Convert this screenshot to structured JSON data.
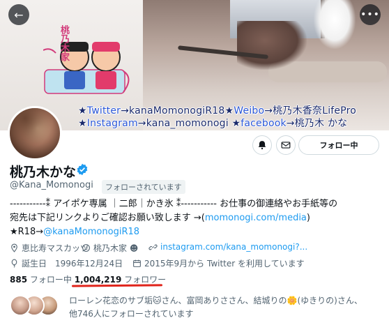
{
  "banner": {
    "kanji": "桃乃木家",
    "line1_parts": [
      "★",
      "Twitter",
      "→kanaMomonogiR18",
      "★",
      "Weibo",
      "→桃乃木香奈LifePro"
    ],
    "line2_parts": [
      "★",
      "Instagram",
      "→kana_momonogi",
      " ★",
      "facebook",
      "→桃乃木 かな"
    ]
  },
  "header": {
    "back_icon": "←",
    "more_icon": "•••"
  },
  "actions": {
    "follow_label": "フォロー中"
  },
  "profile": {
    "name": "桃乃木かな",
    "handle": "@Kana_Momonogi",
    "follows_you": "フォローされています"
  },
  "bio": {
    "line1": "-----------⁑ アイポケ専属 ｜二郎｜かき氷 ⁑----------- お仕事の御連絡やお手紙等の",
    "line2_prefix": "宛先は下記リンクよりご確認お願い致します →(",
    "line2_link": "momonogi.com/media",
    "line2_suffix": ")",
    "line3_prefix": "★R18→",
    "line3_link": "@kanaMomonogiR18"
  },
  "meta": {
    "location": "恵比寿マスカッツ",
    "family": "桃乃木家 ☻",
    "website": "instagram.com/kana_momonogi?...",
    "birthday": "誕生日　1996年12月24日",
    "joined": "2015年9月から Twitter を利用しています"
  },
  "counts": {
    "following": "885",
    "following_label": "フォロー中",
    "followers": "1,004,219",
    "followers_label": "フォロワー"
  },
  "followers_you_know": {
    "line1": "ローレン花恋のサブ垢🐱さん、富岡ありささん、結城りの🌼(ゆきりの)さん、",
    "line2": "他746人にフォローされています"
  }
}
